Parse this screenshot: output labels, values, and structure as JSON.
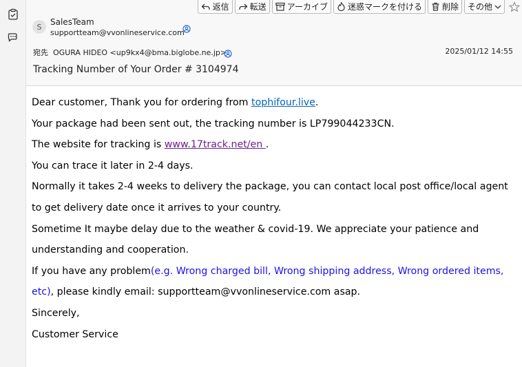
{
  "toolbar": {
    "reply": "返信",
    "forward": "転送",
    "archive": "アーカイブ",
    "junk": "迷惑マークを付ける",
    "delete": "削除",
    "more": "その他"
  },
  "header": {
    "avatar_initial": "S",
    "sender_name": "SalesTeam",
    "sender_email": "supportteam@vvonlineservice.com",
    "to_label": "宛先",
    "to_value": "OGURA HIDEO <up9kx4@bma.biglobe.ne.jp>",
    "date": "2025/01/12 14:55",
    "subject": "Tracking Number of Your Order # 3104974"
  },
  "body": {
    "line1_prefix": "Dear customer, Thank you for ordering from ",
    "line1_link": "tophifour.live",
    "line1_suffix": ".",
    "line2": "Your package had been sent out, the tracking number is LP799044233CN.",
    "line3_prefix": "The website for tracking is ",
    "line3_link": "www.17track.net/en ",
    "line3_suffix": ".",
    "line4": "You can trace it later in 2-4 days.",
    "line5": "Normally it takes 2-4 weeks to delivery the package, you can contact local post office/local agent to get delivery date once it arrives to your country.",
    "line6": "Sometime It maybe delay due to the weather & covid-19. We appreciate your patience and understanding and cooperation.",
    "line7_prefix": "If you have any problem",
    "line7_blue": "(e.g. Wrong charged bill, Wrong shipping address, Wrong ordered items, etc)",
    "line7_suffix": ", please kindly email: supportteam@vvonlineservice.com asap.",
    "line8": "Sincerely,",
    "line9": "Customer Service"
  },
  "colors": {
    "link": "#0563c1",
    "visited_link": "#6b1f8e",
    "highlight_blue": "#1a12e6"
  }
}
